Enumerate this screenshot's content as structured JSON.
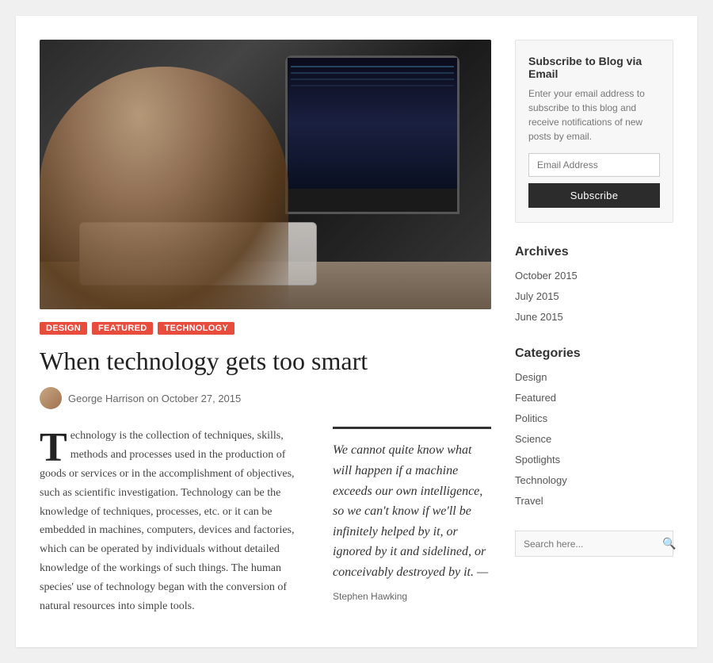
{
  "page": {
    "title": "When technology gets too smart"
  },
  "hero": {
    "alt": "Person using computer at desk"
  },
  "tags": [
    {
      "label": "Design",
      "class": "tag-design"
    },
    {
      "label": "Featured",
      "class": "tag-featured"
    },
    {
      "label": "Technology",
      "class": "tag-technology"
    }
  ],
  "article": {
    "title": "When technology gets too smart",
    "author": "George Harrison",
    "date": "October 27, 2015",
    "author_line": "George Harrison on October 27, 2015",
    "drop_cap": "T",
    "body_text": "echnology is the collection of techniques, skills, methods and processes used in the production of goods or services or in the accomplishment of objectives, such as scientific investigation. Technology can be the knowledge of techniques, processes, etc. or it can be embedded in machines, computers, devices and factories, which can be operated by individuals without detailed knowledge of the workings of such things. The human species' use of technology began with the conversion of natural resources into simple tools.",
    "blockquote": "We cannot quite know what will happen if a machine exceeds our own intelligence, so we can't know if we'll be infinitely helped by it, or ignored by it and sidelined, or conceivably destroyed by it. —",
    "blockquote_author": "Stephen Hawking"
  },
  "sidebar": {
    "subscribe": {
      "title": "Subscribe to Blog via Email",
      "description": "Enter your email address to subscribe to this blog and receive notifications of new posts by email.",
      "email_placeholder": "Email Address",
      "button_label": "Subscribe"
    },
    "archives": {
      "title": "Archives",
      "items": [
        {
          "label": "October 2015",
          "href": "#"
        },
        {
          "label": "July 2015",
          "href": "#"
        },
        {
          "label": "June 2015",
          "href": "#"
        }
      ]
    },
    "categories": {
      "title": "Categories",
      "items": [
        {
          "label": "Design",
          "href": "#"
        },
        {
          "label": "Featured",
          "href": "#"
        },
        {
          "label": "Politics",
          "href": "#"
        },
        {
          "label": "Science",
          "href": "#"
        },
        {
          "label": "Spotlights",
          "href": "#"
        },
        {
          "label": "Technology",
          "href": "#"
        },
        {
          "label": "Travel",
          "href": "#"
        }
      ]
    },
    "search": {
      "placeholder": "Search here...",
      "icon": "🔍"
    }
  }
}
